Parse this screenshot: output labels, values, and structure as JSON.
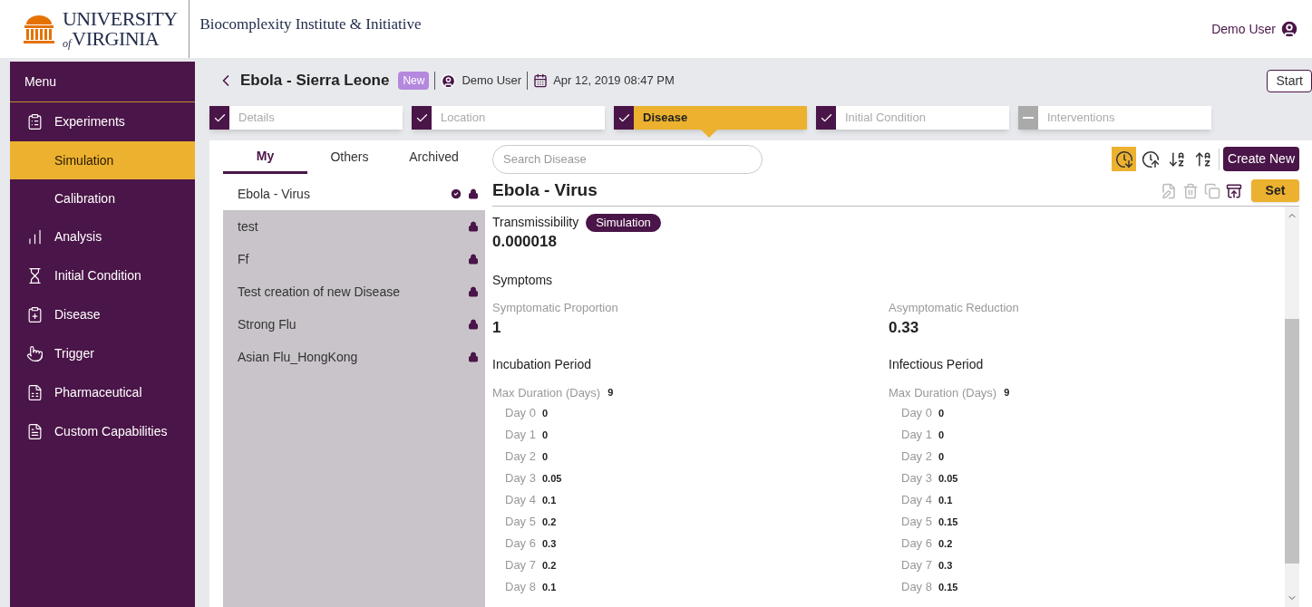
{
  "header": {
    "logo": {
      "top": "UNIVERSITY",
      "small": "of",
      "bottom": "VIRGINIA"
    },
    "institute": "Biocomplexity Institute & Initiative",
    "user": "Demo User"
  },
  "sidebar": {
    "title": "Menu",
    "items": [
      {
        "label": "Experiments",
        "selected": false,
        "children": [
          {
            "label": "Simulation",
            "selected": true
          },
          {
            "label": "Calibration",
            "selected": false
          }
        ]
      },
      {
        "label": "Analysis",
        "selected": false
      },
      {
        "label": "Initial Condition",
        "selected": false
      },
      {
        "label": "Disease",
        "selected": false
      },
      {
        "label": "Trigger",
        "selected": false
      },
      {
        "label": "Pharmaceutical",
        "selected": false
      },
      {
        "label": "Custom Capabilities",
        "selected": false
      }
    ]
  },
  "experiment": {
    "title": "Ebola - Sierra Leone",
    "badge": "New",
    "owner": "Demo User",
    "date": "Apr 12, 2019 08:47 PM",
    "start_button": "Start"
  },
  "steps": [
    {
      "label": "Details",
      "done": true,
      "selected": false
    },
    {
      "label": "Location",
      "done": true,
      "selected": false
    },
    {
      "label": "Disease",
      "done": true,
      "selected": true
    },
    {
      "label": "Initial Condition",
      "done": true,
      "selected": false
    },
    {
      "label": "Interventions",
      "done": false,
      "selected": false
    }
  ],
  "tabs": [
    {
      "label": "My",
      "selected": true
    },
    {
      "label": "Others",
      "selected": false
    },
    {
      "label": "Archived",
      "selected": false
    }
  ],
  "search": {
    "placeholder": "Search Disease"
  },
  "sort_buttons": [
    {
      "selected": true
    },
    {
      "selected": false
    },
    {
      "selected": false
    },
    {
      "selected": false
    }
  ],
  "create_button": "Create New",
  "diseases": [
    {
      "name": "Ebola - Virus",
      "selected": true,
      "verified": true
    },
    {
      "name": "test",
      "selected": false,
      "verified": false
    },
    {
      "name": "Ff",
      "selected": false,
      "verified": false
    },
    {
      "name": "Test creation of new Disease",
      "selected": false,
      "verified": false
    },
    {
      "name": "Strong Flu",
      "selected": false,
      "verified": false
    },
    {
      "name": "Asian Flu_HongKong",
      "selected": false,
      "verified": false
    }
  ],
  "detail": {
    "title": "Ebola - Virus",
    "actions": [
      {
        "disabled": true
      },
      {
        "disabled": true
      },
      {
        "disabled": true
      },
      {
        "disabled": false
      }
    ],
    "set_button": "Set",
    "transmissibility": {
      "label": "Transmissibility",
      "badge": "Simulation",
      "value": "0.000018"
    },
    "symptoms": {
      "title": "Symptoms",
      "fields": [
        {
          "label": "Symptomatic Proportion",
          "value": "1"
        },
        {
          "label": "Asymptomatic Reduction",
          "value": "0.33"
        }
      ]
    },
    "periods": [
      {
        "title": "Incubation Period",
        "max_label": "Max Duration (Days)",
        "max_value": "9",
        "days": [
          {
            "day": "Day 0",
            "value": "0"
          },
          {
            "day": "Day 1",
            "value": "0"
          },
          {
            "day": "Day 2",
            "value": "0"
          },
          {
            "day": "Day 3",
            "value": "0.05"
          },
          {
            "day": "Day 4",
            "value": "0.1"
          },
          {
            "day": "Day 5",
            "value": "0.2"
          },
          {
            "day": "Day 6",
            "value": "0.3"
          },
          {
            "day": "Day 7",
            "value": "0.2"
          },
          {
            "day": "Day 8",
            "value": "0.1"
          }
        ]
      },
      {
        "title": "Infectious Period",
        "max_label": "Max Duration (Days)",
        "max_value": "9",
        "days": [
          {
            "day": "Day 0",
            "value": "0"
          },
          {
            "day": "Day 1",
            "value": "0"
          },
          {
            "day": "Day 2",
            "value": "0"
          },
          {
            "day": "Day 3",
            "value": "0.05"
          },
          {
            "day": "Day 4",
            "value": "0.1"
          },
          {
            "day": "Day 5",
            "value": "0.15"
          },
          {
            "day": "Day 6",
            "value": "0.2"
          },
          {
            "day": "Day 7",
            "value": "0.3"
          },
          {
            "day": "Day 8",
            "value": "0.15"
          }
        ]
      }
    ]
  }
}
